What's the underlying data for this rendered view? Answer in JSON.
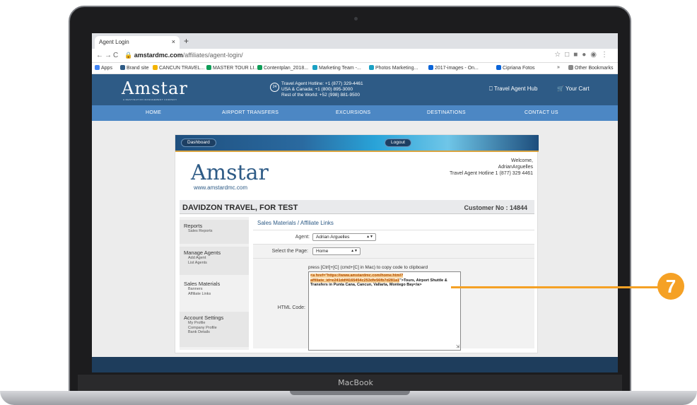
{
  "browser": {
    "tab_title": "Agent Login",
    "tab_close": "×",
    "new_tab": "+",
    "back": "←",
    "forward": "→",
    "reload": "C",
    "url_host": "amstardmc.com",
    "url_path": "/affiliates/agent-login/",
    "bookmarks": [
      "Apps",
      "Brand site",
      "CANCUN TRAVEL...",
      "MASTER TOUR LI...",
      "Contentplan_2018...",
      "Marketing Team -...",
      "Photos Marketing...",
      "2017-images - On...",
      "Cipriana Fotos",
      "»",
      "Other Bookmarks"
    ]
  },
  "header": {
    "logo": "Amstar",
    "logo_sub": "A DESTINATION MANAGEMENT COMPANY",
    "hotline_icon": "24",
    "hotline": [
      "Travel Agent Hotline: +1 (877) 329-4461",
      "USA & Canada: +1 (800) 895-3000",
      "Rest of the World: +52 (998) 881-9500"
    ],
    "hub": "Travel Agent Hub",
    "cart": "Your Cart"
  },
  "nav": [
    "HOME",
    "AIRPORT TRANSFERS",
    "EXCURSIONS",
    "DESTINATIONS",
    "CONTACT US"
  ],
  "panel": {
    "dashboard": "Dashboard",
    "logout": "Logout",
    "logo": "Amstar",
    "url": "www.amstardmc.com",
    "welcome": [
      "Welcome,",
      "AdrianArguelles",
      "Travel Agent Hotline 1 (877) 329 4461"
    ],
    "agency": "DAVIDZON TRAVEL, FOR TEST",
    "customer": "Customer No : 14844"
  },
  "sidebar": {
    "groups": [
      {
        "title": "Reports",
        "items": [
          "Sales Reports"
        ]
      },
      {
        "title": "Manage Agents",
        "items": [
          "Add Agent",
          "List Agents"
        ]
      },
      {
        "title": "Sales Materials",
        "items": [
          "Banners",
          "Affiliate Links"
        ]
      },
      {
        "title": "Account Settings",
        "items": [
          "My Profile",
          "Company Profile",
          "Bank Details"
        ]
      }
    ]
  },
  "content": {
    "crumb": "Sales Materials  /  Affiliate Links",
    "agent_label": "Agent:",
    "agent_value": "Adrian Arguelles",
    "page_label": "Select the Page:",
    "page_value": "Home",
    "hint": "press [Ctrl]+[C] (cmd+[C] in Mac) to copy code to clipboard",
    "html_label": "HTML Code:",
    "code_pre": "<a href=\"",
    "code_link": "https://www.amstardmc.com/home.html?affiliate_id=e241ddf4165454c253dfe56fb7d281a1",
    "code_post": "\">Tours, Airport Shuttle & Transfers in Punta Cana, Cancun, Vallarta, Montego Bay</a>"
  },
  "device": {
    "brand": "MacBook"
  },
  "callout": {
    "number": "7",
    "color": "#f5a125"
  },
  "colors": {
    "header": "#2e5b86",
    "nav": "#4c87c4",
    "highlight": "#f7d29a"
  }
}
